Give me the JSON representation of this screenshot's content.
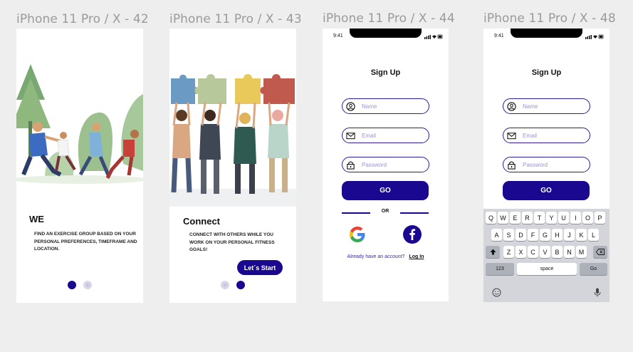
{
  "frames": [
    {
      "title": "iPhone 11 Pro / X - 42",
      "heading": "WE",
      "body": "FIND AN EXERCISE GROUP BASED ON YOUR PERSONAL PREFERENCES, TIMEFRAME AND LOCATION.",
      "dots": [
        "active",
        "inactive"
      ]
    },
    {
      "title": "iPhone 11 Pro / X - 43",
      "heading": "Connect",
      "body": "CONNECT WITH OTHERS WHILE YOU WORK ON YOUR PERSONAL FITNESS GOALS!",
      "button": "Let´s Start",
      "dots": [
        "inactive",
        "active"
      ]
    },
    {
      "title": "iPhone 11 Pro / X - 44",
      "time": "9:41",
      "heading": "Sign Up",
      "name_placeholder": "Name",
      "email_placeholder": "Email",
      "password_placeholder": "Password",
      "go": "GO",
      "or": "OR",
      "account_question": "Already have an account?",
      "login": "Log In",
      "social_icons": [
        "google-icon",
        "facebook-icon"
      ]
    },
    {
      "title": "iPhone 11 Pro / X - 48",
      "time": "9:41",
      "heading": "Sign Up",
      "name_placeholder": "Name",
      "email_placeholder": "Email",
      "password_placeholder": "Password",
      "go": "GO",
      "keyboard": {
        "row1": [
          "Q",
          "W",
          "E",
          "R",
          "T",
          "Y",
          "U",
          "I",
          "O",
          "P"
        ],
        "row2": [
          "A",
          "S",
          "D",
          "F",
          "G",
          "H",
          "J",
          "K",
          "L"
        ],
        "row3": [
          "Z",
          "X",
          "C",
          "V",
          "B",
          "N",
          "M"
        ],
        "numbers": "123",
        "space": "space",
        "go": "Go"
      }
    }
  ],
  "colors": {
    "primary": "#1a0890",
    "background": "#eeeeee",
    "placeholder": "#9b93d6",
    "facebook": "#1a0890"
  }
}
